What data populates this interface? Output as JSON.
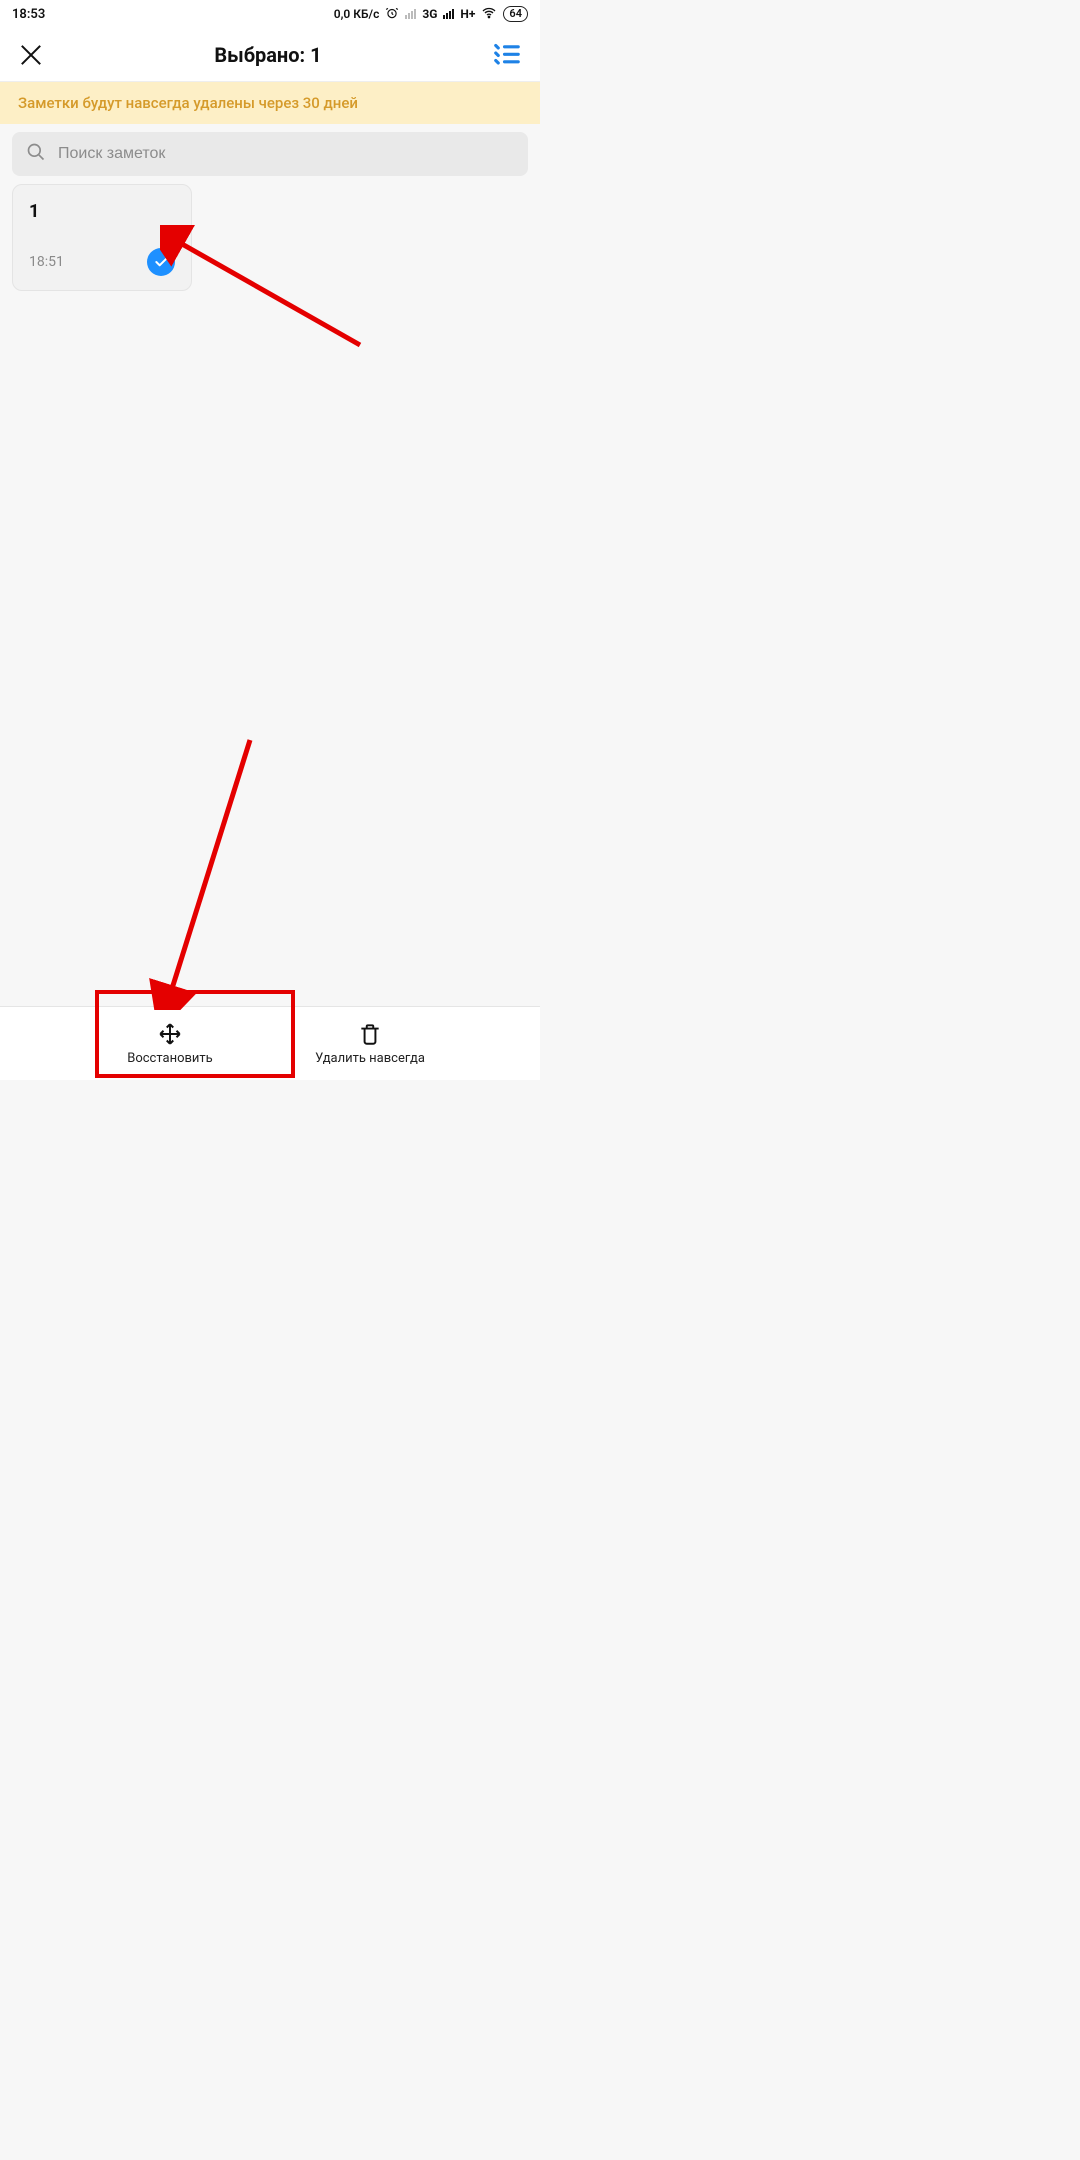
{
  "statusbar": {
    "time": "18:53",
    "speed": "0,0 КБ/с",
    "net1": "3G",
    "net2": "H+",
    "battery": "64"
  },
  "header": {
    "title": "Выбрано: 1"
  },
  "banner": {
    "text": "Заметки будут навсегда удалены через 30 дней"
  },
  "search": {
    "placeholder": "Поиск заметок"
  },
  "notes": [
    {
      "title": "1",
      "time": "18:51",
      "selected": true
    }
  ],
  "actions": {
    "restore": "Восстановить",
    "delete": "Удалить навсегда"
  }
}
